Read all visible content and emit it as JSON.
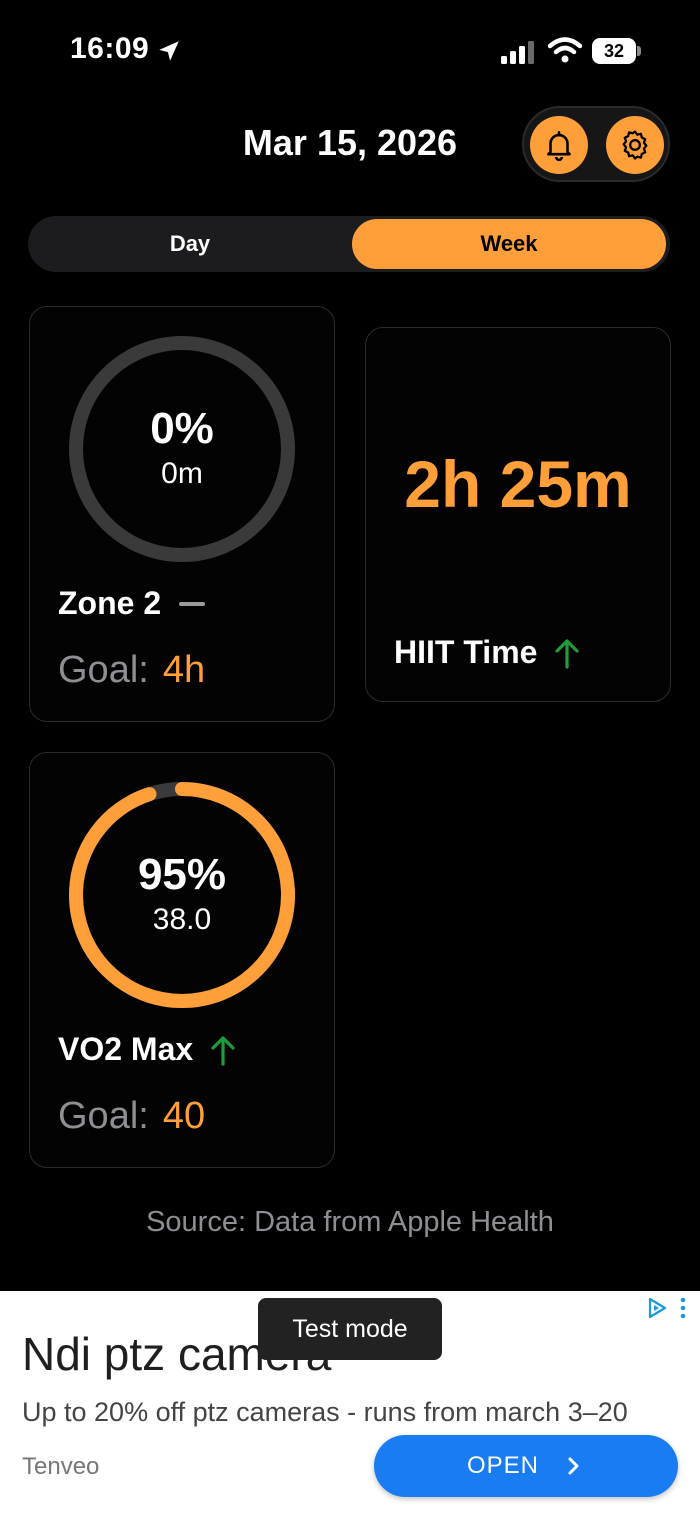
{
  "status_bar": {
    "time": "16:09",
    "battery": "32"
  },
  "header": {
    "date": "Mar 15, 2026",
    "icons": [
      "bell-icon",
      "gear-icon"
    ]
  },
  "segment": {
    "tabs": [
      "Day",
      "Week"
    ],
    "selected": "Week"
  },
  "cards": {
    "zone2": {
      "percent": "0%",
      "value": "0m",
      "label": "Zone 2",
      "goal_label": "Goal:",
      "goal_value": "4h",
      "trend": "none",
      "progress": 0
    },
    "hiit": {
      "value": "2h 25m",
      "label": "HIIT Time",
      "trend": "up"
    },
    "vo2": {
      "percent": "95%",
      "value": "38.0",
      "label": "VO2 Max",
      "goal_label": "Goal:",
      "goal_value": "40",
      "trend": "up",
      "progress": 0.95
    }
  },
  "source": "Source: Data from Apple Health",
  "ad": {
    "headline": "Ndi ptz camera",
    "description": "Up to 20% off ptz cameras - runs from march 3–20",
    "advertiser": "Tenveo",
    "cta": "OPEN",
    "toast": "Test mode"
  },
  "colors": {
    "accent": "#FF9F3A",
    "trend_up": "#1F9D3A",
    "ad_button": "#1A7CF3"
  }
}
